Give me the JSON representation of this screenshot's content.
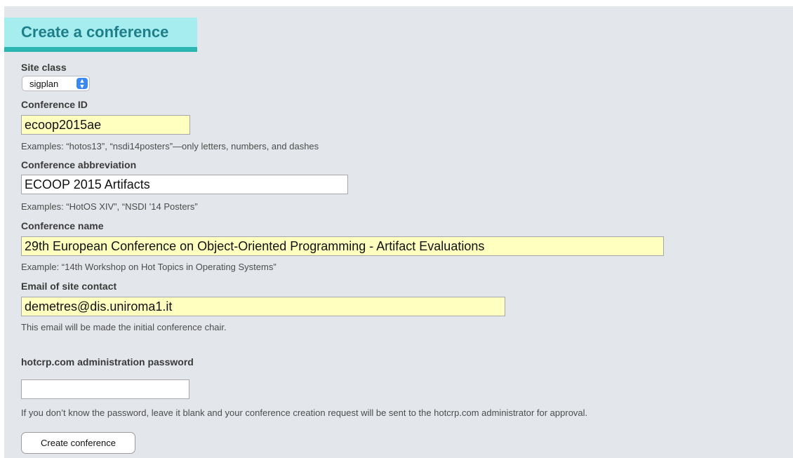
{
  "page": {
    "title": "Create a conference"
  },
  "form": {
    "site_class": {
      "label": "Site class",
      "selected": "sigplan"
    },
    "conference_id": {
      "label": "Conference ID",
      "value": "ecoop2015ae",
      "hint": "Examples: “hotos13”, “nsdi14posters”—only letters, numbers, and dashes"
    },
    "conference_abbreviation": {
      "label": "Conference abbreviation",
      "value": "ECOOP 2015 Artifacts",
      "hint": "Examples: “HotOS XIV”, “NSDI '14 Posters”"
    },
    "conference_name": {
      "label": "Conference name",
      "value": "29th European Conference on Object-Oriented Programming - Artifact Evaluations",
      "hint": "Example: “14th Workshop on Hot Topics in Operating Systems”"
    },
    "site_contact_email": {
      "label": "Email of site contact",
      "value": "demetres@dis.uniroma1.it",
      "hint": "This email will be made the initial conference chair."
    },
    "admin_password": {
      "label": "hotcrp.com administration password",
      "value": "",
      "hint": "If you don’t know the password, leave it blank and your conference creation request will be sent to the hotcrp.com administrator for approval."
    },
    "submit_label": "Create conference"
  },
  "colors": {
    "panel_background": "#e3e6ea",
    "heading_background": "#a6edf0",
    "heading_underline": "#2bb6b2",
    "heading_text": "#1f7f89",
    "filled_input_background": "#ffffc0",
    "select_arrow": "#3a89f3"
  },
  "icons": {
    "select_arrow": "chevron-up-down-icon"
  }
}
